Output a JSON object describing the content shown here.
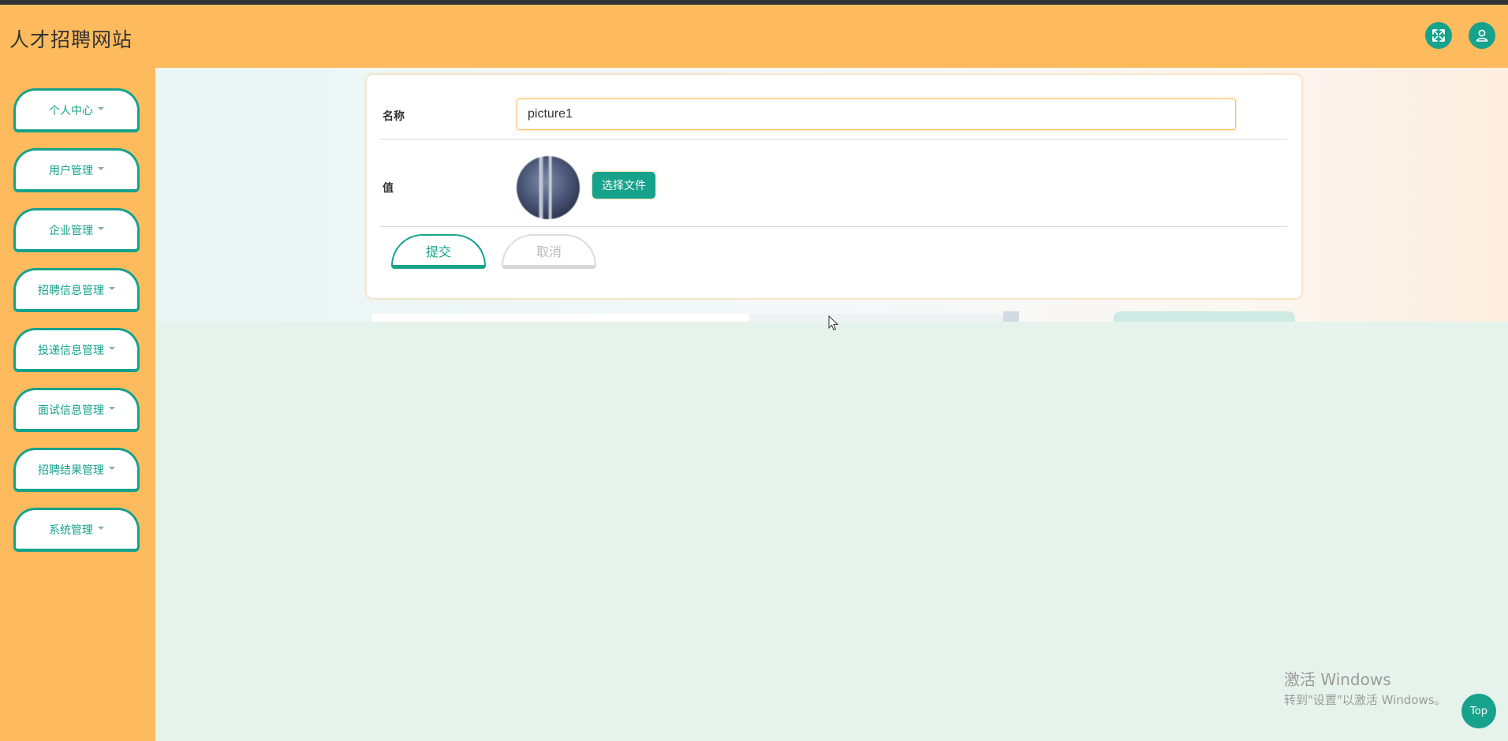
{
  "header": {
    "title": "人才招聘网站",
    "fullscreen_icon": "expand-icon",
    "user_icon": "user-icon"
  },
  "sidebar": {
    "items": [
      {
        "label": "个人中心"
      },
      {
        "label": "用户管理"
      },
      {
        "label": "企业管理"
      },
      {
        "label": "招聘信息管理"
      },
      {
        "label": "投递信息管理"
      },
      {
        "label": "面试信息管理"
      },
      {
        "label": "招聘结果管理"
      },
      {
        "label": "系统管理"
      }
    ]
  },
  "form": {
    "name_label": "名称",
    "name_value": "picture1",
    "value_label": "值",
    "choose_file_label": "选择文件",
    "submit_label": "提交",
    "cancel_label": "取消"
  },
  "watermark": {
    "line1": "激活 Windows",
    "line2": "转到\"设置\"以激活 Windows。"
  },
  "top_button": {
    "label": "Top"
  },
  "colors": {
    "brand_orange": "#fdbb5d",
    "accent_teal": "#17a28c",
    "content_bg": "#e6f3ec"
  }
}
